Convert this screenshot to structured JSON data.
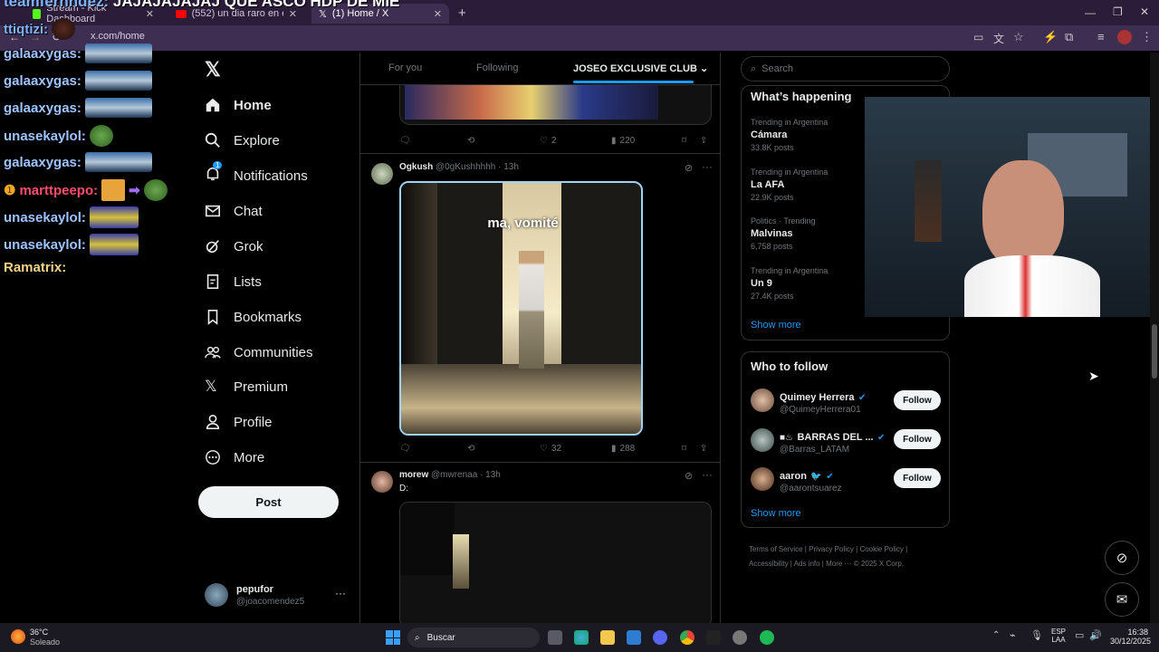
{
  "browser": {
    "tabs": [
      {
        "label": "Stream - Kick Dashboard"
      },
      {
        "label": "(552) un dia raro en el chat - Yo"
      },
      {
        "label": "(1) Home / X"
      }
    ],
    "url": "x.com/home",
    "overlay_title": "JAJAJAJAJAJ QUE ASCO HDP DE MIE"
  },
  "chat": [
    {
      "user": "ttiqtizi:",
      "color": "#7fb3ff"
    },
    {
      "user": "galaaxygas:",
      "color": "#9ec4ff"
    },
    {
      "user": "galaaxygas:",
      "color": "#9ec4ff"
    },
    {
      "user": "galaaxygas:",
      "color": "#9ec4ff"
    },
    {
      "user": "unasekaylol:",
      "color": "#9ec4ff"
    },
    {
      "user": "galaaxygas:",
      "color": "#9ec4ff"
    },
    {
      "user": "marttpeepo:",
      "color": "#ff4d6d"
    },
    {
      "user": "unasekaylol:",
      "color": "#9ec4ff"
    },
    {
      "user": "unasekaylol:",
      "color": "#9ec4ff"
    },
    {
      "user": "Ramatrix:",
      "color": "#f2d38a"
    }
  ],
  "nav": {
    "items": [
      "Home",
      "Explore",
      "Notifications",
      "Chat",
      "Grok",
      "Lists",
      "Bookmarks",
      "Communities",
      "Premium",
      "Profile",
      "More"
    ],
    "notif_badge": "1",
    "post_label": "Post",
    "account": {
      "name": "pepufor",
      "handle": "@joacomendez5"
    }
  },
  "feed": {
    "tabs": [
      "For you",
      "Following",
      "JOSEO EXCLUSIVE CLUB"
    ],
    "post0_stats": {
      "likes": "2",
      "views": "220"
    },
    "post1": {
      "name": "Ogkush",
      "handle": "@0gKushhhhh",
      "time": "· 13h",
      "media_caption": "ma, vomité",
      "likes": "32",
      "views": "288"
    },
    "post2": {
      "name": "morew",
      "handle": "@mwrenaa",
      "time": "· 13h",
      "text": "D:"
    }
  },
  "right": {
    "search_placeholder": "Search",
    "happening_title": "What’s happening",
    "trends": [
      {
        "meta": "Trending in Argentina",
        "name": "Cámara",
        "posts": "33.8K posts"
      },
      {
        "meta": "Trending in Argentina",
        "name": "La AFA",
        "posts": "22.9K posts"
      },
      {
        "meta": "Politics · Trending",
        "name": "Malvinas",
        "posts": "6,758 posts"
      },
      {
        "meta": "Trending in Argentina",
        "name": "Un 9",
        "posts": "27.4K posts"
      }
    ],
    "show_more": "Show more",
    "wtf_title": "Who to follow",
    "wtf": [
      {
        "name": "Quimey Herrera",
        "handle": "@QuimeyHerrera01",
        "btn": "Follow"
      },
      {
        "name": "BARRAS DEL ...",
        "handle": "@Barras_LATAM",
        "btn": "Follow"
      },
      {
        "name": "aaron",
        "handle": "@aarontsuarez",
        "btn": "Follow"
      }
    ],
    "footer": [
      "Terms of Service",
      "Privacy Policy",
      "Cookie Policy",
      "Accessibility",
      "Ads info",
      "More ···",
      "© 2025 X Corp."
    ]
  },
  "taskbar": {
    "weather_temp": "36°C",
    "weather_desc": "Soleado",
    "search": "Buscar",
    "lang": "ESP",
    "lang2": "LAA",
    "time": "16:38",
    "date": "30/12/2025"
  }
}
